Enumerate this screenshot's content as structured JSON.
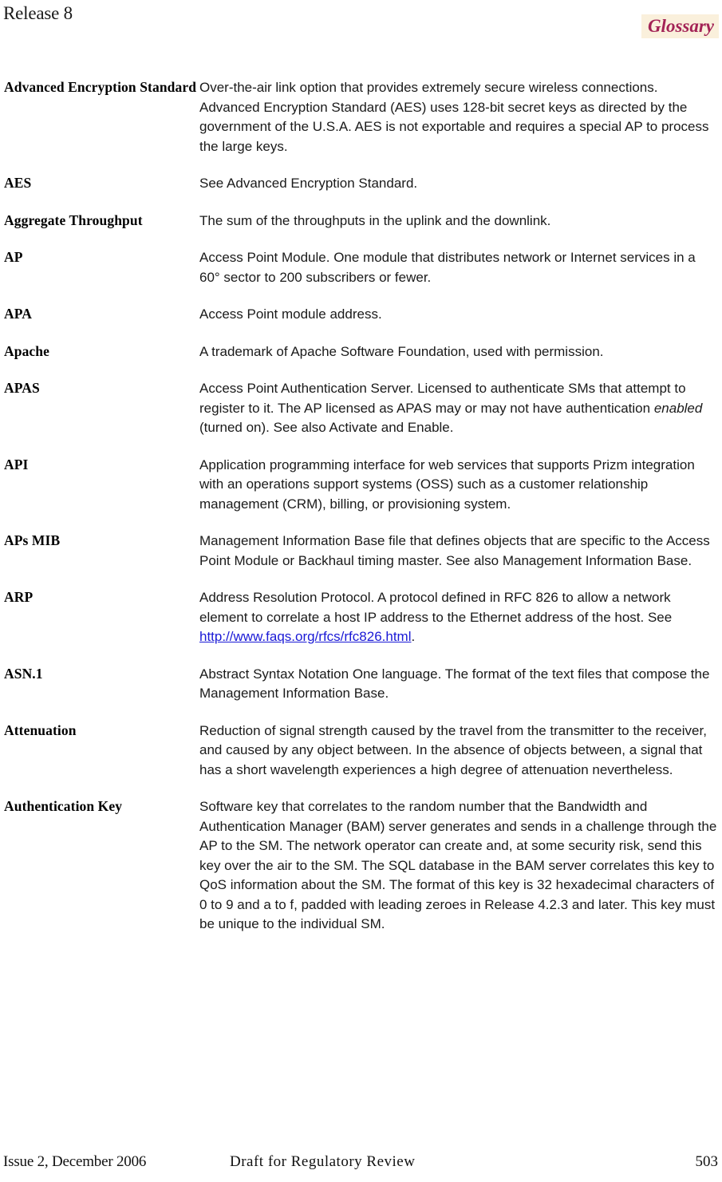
{
  "header": {
    "release": "Release 8",
    "chapter": "Glossary",
    "chapter_text_color": "#a32356",
    "chapter_bg_color": "#faf0dc"
  },
  "glossary": {
    "entries": [
      {
        "term": "Advanced Encryption Standard",
        "definition": "Over-the-air link option that provides extremely secure wireless connections. Advanced Encryption Standard (AES) uses 128-bit secret keys as directed by the government of the U.S.A. AES is not exportable and requires a special AP to process the large keys."
      },
      {
        "term": "AES",
        "definition": "See Advanced Encryption Standard."
      },
      {
        "term": "Aggregate Throughput",
        "definition": "The sum of the throughputs in the uplink and the downlink."
      },
      {
        "term": "AP",
        "definition": "Access Point Module. One module that distributes network or Internet services in a 60° sector to 200 subscribers or fewer."
      },
      {
        "term": "APA",
        "definition": "Access Point module address."
      },
      {
        "term": "Apache",
        "definition": "A trademark of Apache Software Foundation, used with permission."
      },
      {
        "term": "APAS",
        "definition_parts": [
          {
            "type": "text",
            "text": "Access Point Authentication Server. Licensed to authenticate SMs that attempt to register to it. The AP licensed as APAS may or may not have authentication "
          },
          {
            "type": "italic",
            "text": "enabled"
          },
          {
            "type": "text",
            "text": " (turned on). See also Activate and Enable."
          }
        ]
      },
      {
        "term": "API",
        "definition": "Application programming interface for web services that supports Prizm integration with an operations support systems (OSS) such as a customer relationship management (CRM), billing, or provisioning system."
      },
      {
        "term": "APs MIB",
        "definition": "Management Information Base file that defines objects that are specific to the Access Point Module or Backhaul timing master. See also Management Information Base."
      },
      {
        "term": "ARP",
        "definition_parts": [
          {
            "type": "text",
            "text": "Address Resolution Protocol. A protocol defined in RFC 826 to allow a network element to correlate a host IP address to the Ethernet address of the host. See "
          },
          {
            "type": "link",
            "text": "http://www.faqs.org/rfcs/rfc826.html",
            "color": "#1a19d6"
          },
          {
            "type": "text",
            "text": "."
          }
        ]
      },
      {
        "term": "ASN.1",
        "definition": "Abstract Syntax Notation One language. The format of the text files that compose the Management Information Base."
      },
      {
        "term": "Attenuation",
        "definition": "Reduction of signal strength caused by the travel from the transmitter to the receiver, and caused by any object between. In the absence of objects between, a signal that has a short wavelength experiences a high degree of attenuation nevertheless."
      },
      {
        "term": "Authentication Key",
        "definition": "Software key that correlates to the random number that the Bandwidth and Authentication Manager (BAM) server generates and sends in a challenge through the AP to the SM. The network operator can create and, at some security risk, send this key over the air to the SM. The SQL database in the BAM server correlates this key to QoS information about the SM. The format of this key is 32  hexadecimal characters of 0 to 9 and a to f, padded with leading zeroes in Release 4.2.3 and later. This key must be unique to the individual SM."
      }
    ]
  },
  "footer": {
    "left": "Issue 2, December 2006",
    "center": "Draft for Regulatory Review",
    "page_number": "503"
  }
}
